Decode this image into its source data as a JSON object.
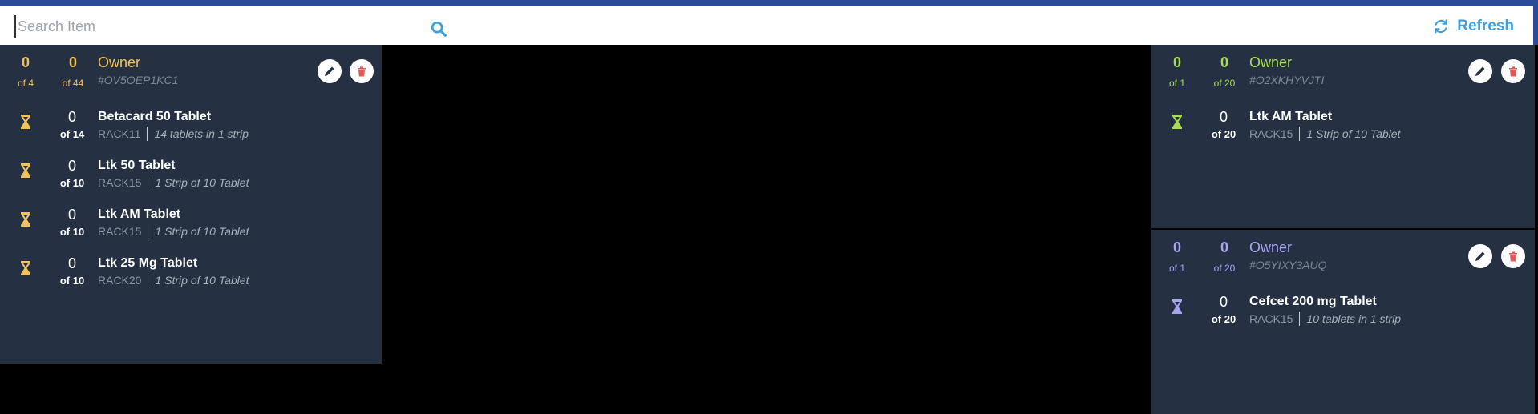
{
  "search": {
    "placeholder": "Search Item"
  },
  "header": {
    "refresh_label": "Refresh"
  },
  "orders": [
    {
      "color": "#f2c35a",
      "count_done": "0",
      "count_total": "of 4",
      "qty_done": "0",
      "qty_total": "of 44",
      "owner": "Owner",
      "code": "#OV5OEP1KC1",
      "items": [
        {
          "done": "0",
          "total": "of 14",
          "name": "Betacard 50 Tablet",
          "rack": "RACK11",
          "pack": "14 tablets in 1 strip"
        },
        {
          "done": "0",
          "total": "of 10",
          "name": "Ltk 50 Tablet",
          "rack": "RACK15",
          "pack": "1 Strip of 10 Tablet"
        },
        {
          "done": "0",
          "total": "of 10",
          "name": "Ltk AM Tablet",
          "rack": "RACK15",
          "pack": "1 Strip of 10 Tablet"
        },
        {
          "done": "0",
          "total": "of 10",
          "name": "Ltk 25 Mg Tablet",
          "rack": "RACK20",
          "pack": "1 Strip of 10 Tablet"
        }
      ]
    },
    {
      "color": "#a8dc57",
      "count_done": "0",
      "count_total": "of 1",
      "qty_done": "0",
      "qty_total": "of 20",
      "owner": "Owner",
      "code": "#O2XKHYVJTI",
      "items": [
        {
          "done": "0",
          "total": "of 20",
          "name": "Ltk AM Tablet",
          "rack": "RACK15",
          "pack": "1 Strip of 10 Tablet"
        }
      ]
    },
    {
      "color": "#a9a3f2",
      "count_done": "0",
      "count_total": "of 1",
      "qty_done": "0",
      "qty_total": "of 20",
      "owner": "Owner",
      "code": "#O5YIXY3AUQ",
      "items": [
        {
          "done": "0",
          "total": "of 20",
          "name": "Cefcet 200 mg Tablet",
          "rack": "RACK15",
          "pack": "10 tablets in 1 strip"
        }
      ]
    }
  ],
  "icons": {
    "search": "search-icon",
    "refresh": "refresh-icon",
    "edit": "pencil-icon",
    "delete": "trash-icon",
    "status": "hourglass-icon"
  },
  "colors": {
    "top_bar": "#2a4a9a",
    "accent": "#3aa0e0",
    "card_bg": "#253142",
    "delete": "#e05a5a"
  }
}
